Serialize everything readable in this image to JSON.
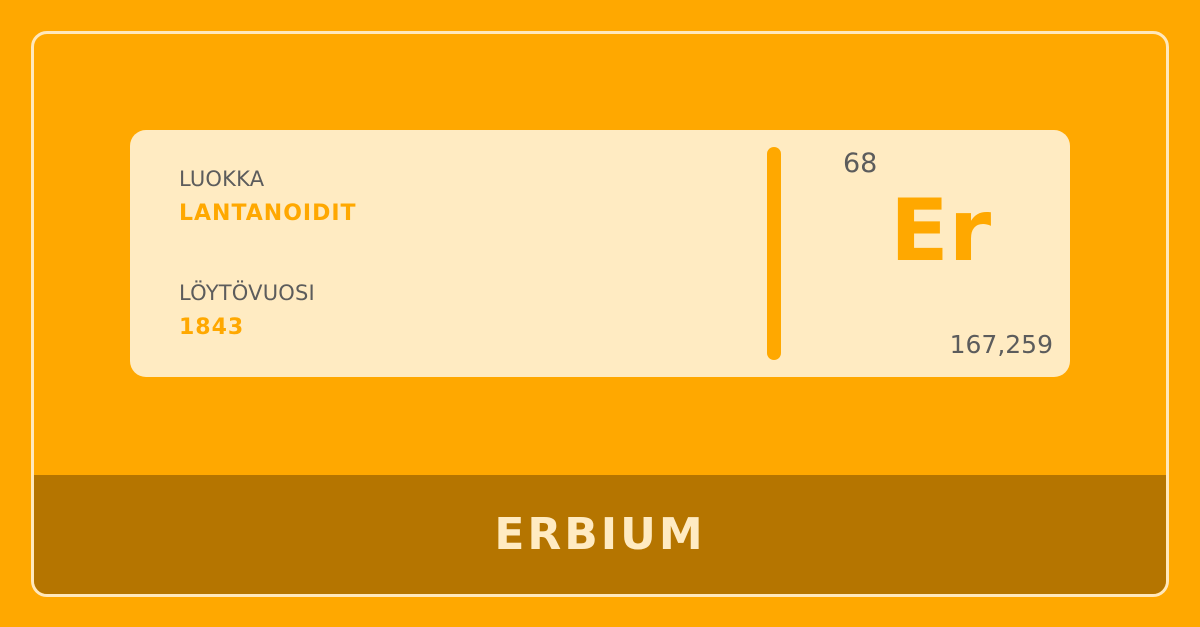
{
  "colors": {
    "background": "#FFA800",
    "panel": "#FFEBC2",
    "accent": "#FFA800",
    "name_bar": "#B57500",
    "text": "#5C5C5C"
  },
  "element": {
    "category_label": "LUOKKA",
    "category_value": "LANTANOIDIT",
    "discovery_label": "LÖYTÖVUOSI",
    "discovery_value": "1843",
    "atomic_number": "68",
    "symbol": "Er",
    "atomic_mass": "167,259",
    "name": "ERBIUM"
  }
}
